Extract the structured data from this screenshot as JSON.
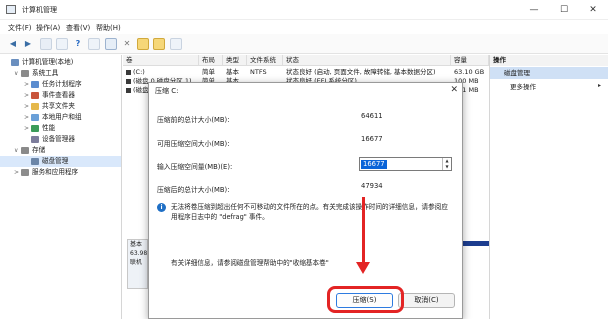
{
  "window": {
    "title": "计算机管理",
    "controls": {
      "minimize": "—",
      "maximize": "☐",
      "close": "✕"
    }
  },
  "menu": [
    "文件(F)",
    "操作(A)",
    "查看(V)",
    "帮助(H)"
  ],
  "tree": {
    "items": [
      {
        "label": "计算机管理(本地)",
        "indent": 0,
        "expand": "",
        "icon": "computer-icon",
        "selected": false
      },
      {
        "label": "系统工具",
        "indent": 1,
        "expand": "∨",
        "icon": "tools-icon",
        "selected": false
      },
      {
        "label": "任务计划程序",
        "indent": 2,
        "expand": ">",
        "icon": "clock-icon",
        "selected": false
      },
      {
        "label": "事件查看器",
        "indent": 2,
        "expand": ">",
        "icon": "event-icon",
        "selected": false
      },
      {
        "label": "共享文件夹",
        "indent": 2,
        "expand": ">",
        "icon": "folder-icon",
        "selected": false
      },
      {
        "label": "本地用户和组",
        "indent": 2,
        "expand": ">",
        "icon": "users-icon",
        "selected": false
      },
      {
        "label": "性能",
        "indent": 2,
        "expand": ">",
        "icon": "performance-icon",
        "selected": false
      },
      {
        "label": "设备管理器",
        "indent": 2,
        "expand": "",
        "icon": "device-icon",
        "selected": false
      },
      {
        "label": "存储",
        "indent": 1,
        "expand": "∨",
        "icon": "storage-icon",
        "selected": false
      },
      {
        "label": "磁盘管理",
        "indent": 2,
        "expand": "",
        "icon": "disk-icon",
        "selected": true
      },
      {
        "label": "服务和应用程序",
        "indent": 1,
        "expand": ">",
        "icon": "services-icon",
        "selected": false
      }
    ]
  },
  "volumes": {
    "headers": [
      "卷",
      "布局",
      "类型",
      "文件系统",
      "状态",
      "容量"
    ],
    "rows": [
      {
        "vol": "(C:)",
        "layout": "简单",
        "type": "基本",
        "fs": "NTFS",
        "status": "状态良好 (启动, 页面文件, 故障转储, 基本数据分区)",
        "capacity": "63.10 GB"
      },
      {
        "vol": "(磁盘 0 磁盘分区 1)",
        "layout": "简单",
        "type": "基本",
        "fs": "",
        "status": "状态良好 (EFI 系统分区)",
        "capacity": "100 MB"
      },
      {
        "vol": "(磁盘 0 磁盘分区 4)",
        "layout": "简单",
        "type": "基本",
        "fs": "",
        "status": "状态良好 (恢复分区)",
        "capacity": "841 MB"
      }
    ]
  },
  "actions": {
    "header": "操作",
    "selected": "磁盘管理",
    "more": "更多操作"
  },
  "disk_panel": {
    "lines": [
      "基本",
      "63.98",
      "联机"
    ]
  },
  "dialog": {
    "title": "压缩 C:",
    "total_before_label": "压缩前的总计大小(MB):",
    "total_before_value": "64611",
    "available_label": "可用压缩空间大小(MB):",
    "available_value": "16677",
    "input_label": "输入压缩空间量(MB)(E):",
    "input_value": "16677",
    "total_after_label": "压缩后的总计大小(MB):",
    "total_after_value": "47934",
    "info": "无法将卷压缩到超出任何不可移动的文件所在的点。有关完成该操作时间的详细信息，请参阅应用程序日志中的 \"defrag\" 事件。",
    "note": "有关详细信息，请参阅磁盘管理帮助中的\"收缩基本卷\"",
    "shrink_button": "压缩(S)",
    "cancel_button": "取消(C)",
    "close": "✕"
  },
  "colors": {
    "highlight": "#e32424",
    "selection": "#0a64d8"
  }
}
